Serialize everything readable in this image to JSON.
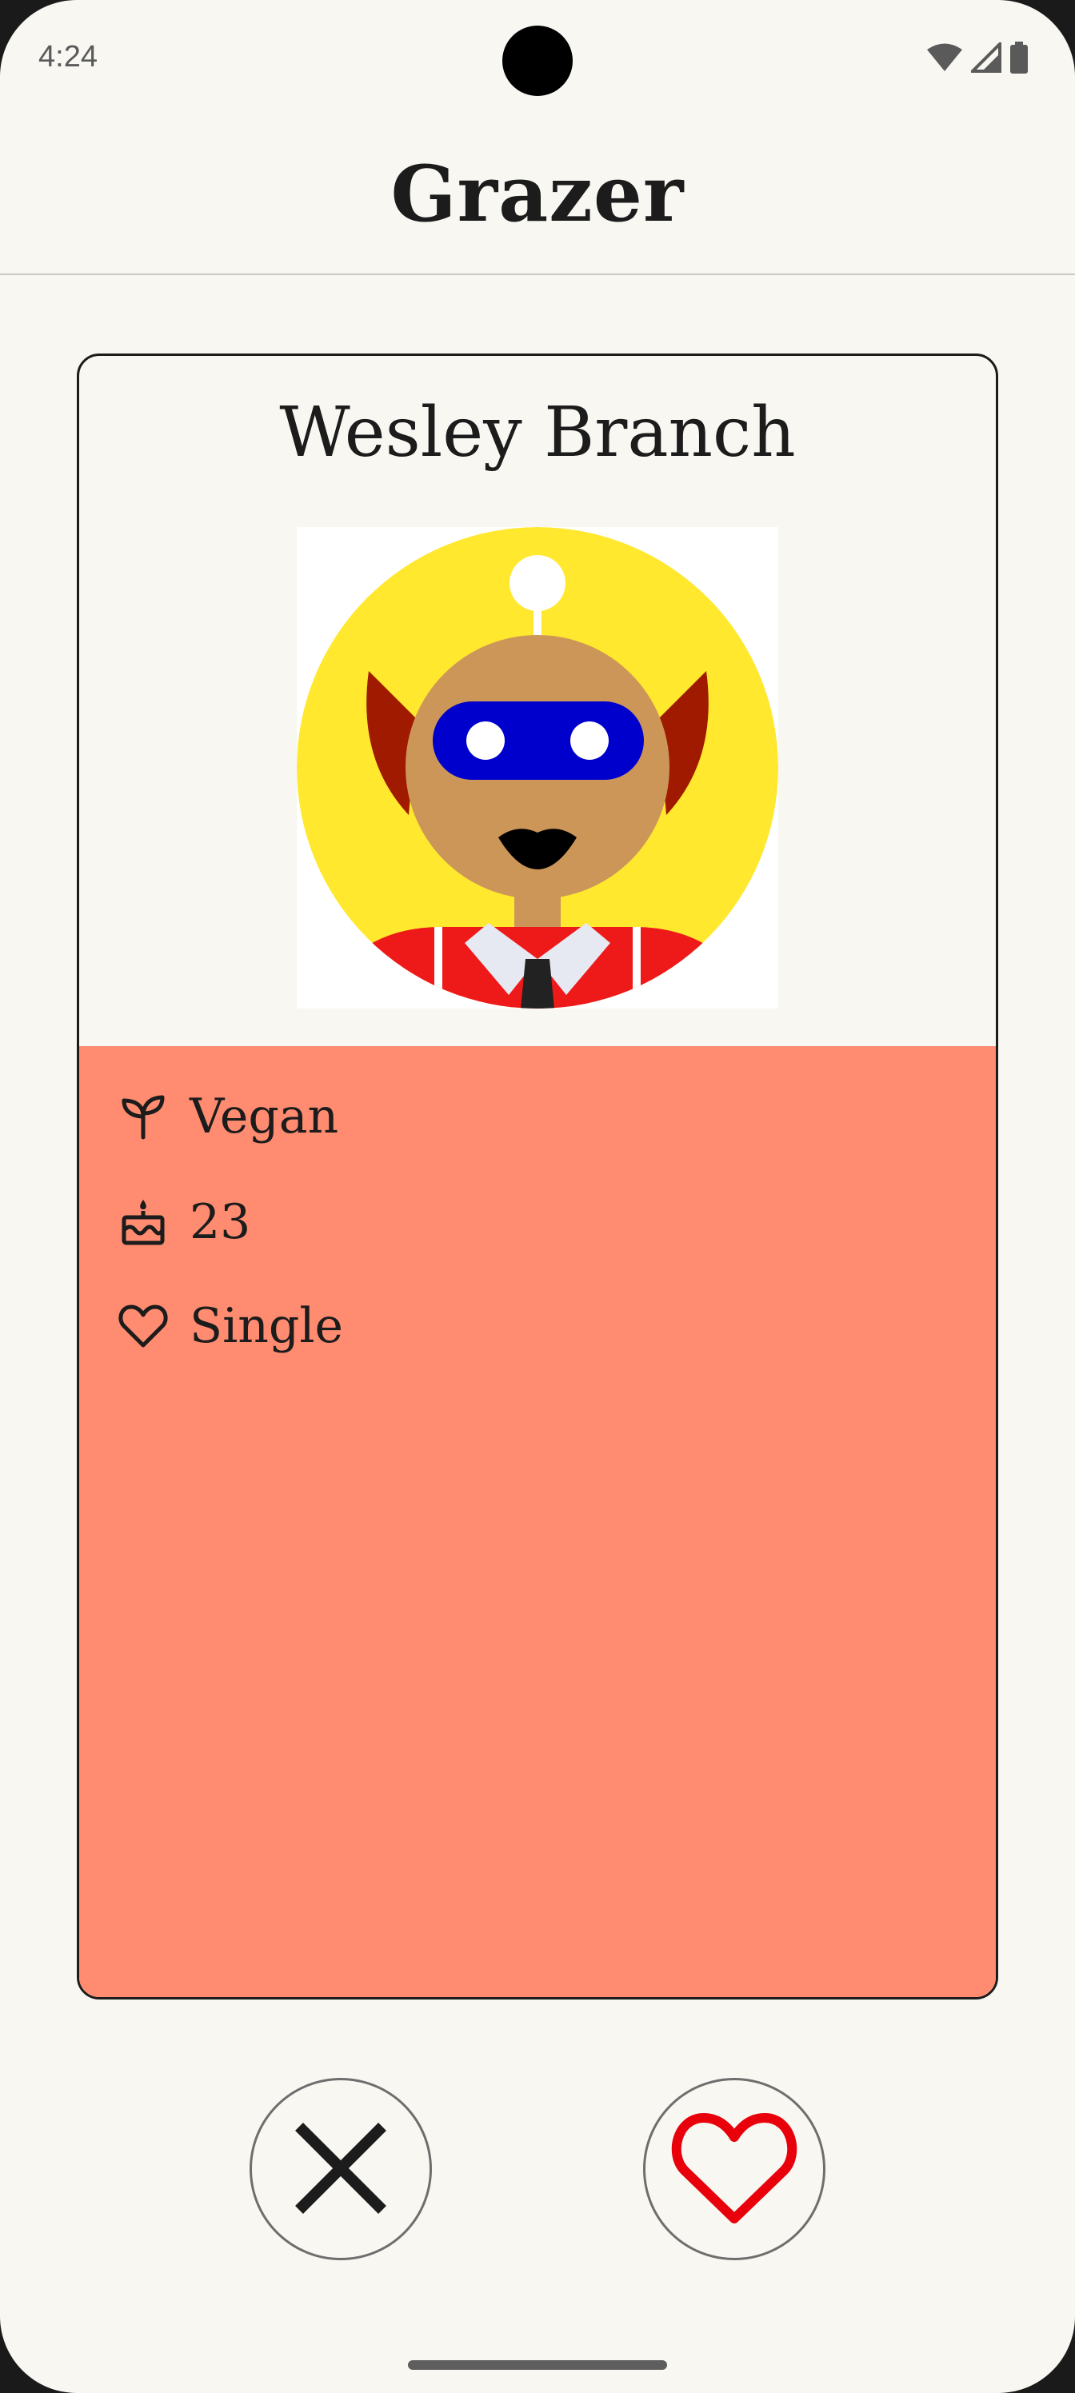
{
  "status_bar": {
    "time": "4:24",
    "icons": [
      "wifi-icon",
      "cellular-signal-icon",
      "battery-icon"
    ]
  },
  "app_bar": {
    "title": "Grazer"
  },
  "profile": {
    "name": "Wesley Branch",
    "avatar": "robot-avatar-image",
    "details": [
      {
        "icon": "sprout-icon",
        "label": "Vegan"
      },
      {
        "icon": "cake-icon",
        "label": "23"
      },
      {
        "icon": "heart-outline-icon",
        "label": "Single"
      }
    ]
  },
  "actions": {
    "dislike_icon": "close-icon",
    "like_icon": "heart-icon"
  },
  "colors": {
    "background": "#f8f7f1",
    "details_panel": "#ff8c70",
    "like_heart": "#e8000a",
    "avatar_circle": "#ffe82e",
    "avatar_visor": "#0000cc"
  }
}
